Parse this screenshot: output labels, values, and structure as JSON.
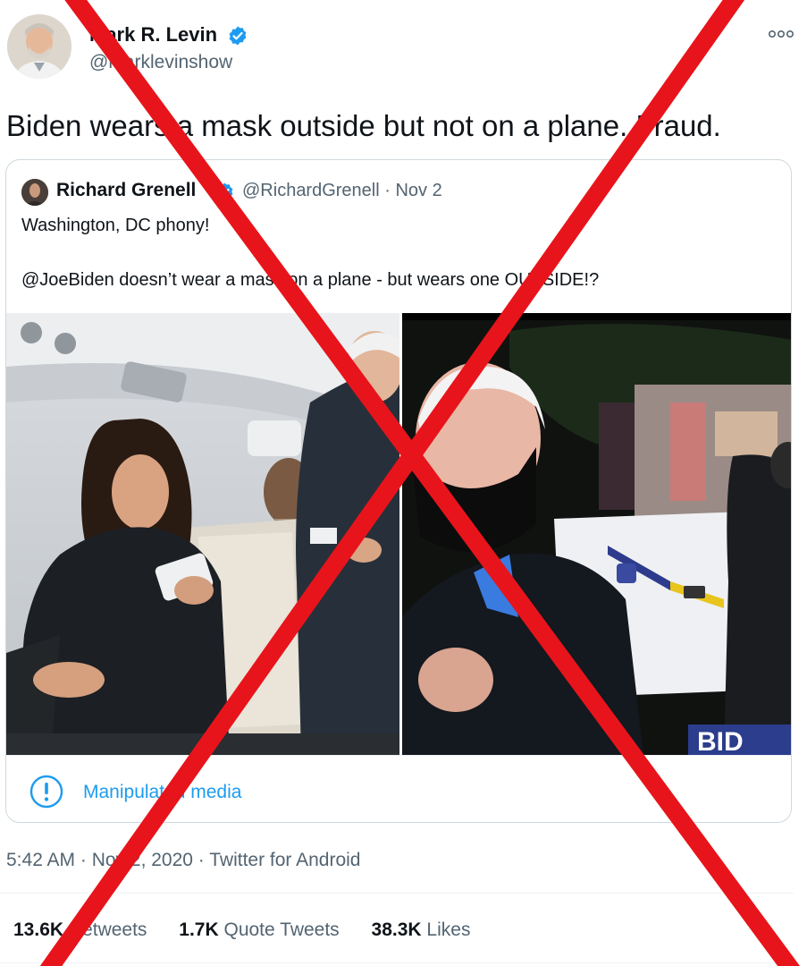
{
  "tweet": {
    "author": {
      "name": "Mark R. Levin",
      "handle": "@marklevinshow",
      "verified": true,
      "avatar": "avatar-photo"
    },
    "text": "Biden wears a mask outside but not on a plane. Fraud.",
    "more_icon": "more-horizontal-icon",
    "quoted": {
      "author_name": "Richard Grenell",
      "verified": true,
      "meta": "@RichardGrenell · Nov 2",
      "line1": "Washington, DC phony!",
      "line2": "@JoeBiden doesn’t wear a mask on a plane - but wears one OUTSIDE!?",
      "photo_right_caption": "BID",
      "notice": {
        "icon": "exclamation-circle-icon",
        "text": "Manipulated media"
      }
    },
    "timestamp": "5:42 AM · Nov 2, 2020 · Twitter for Android",
    "stats": {
      "retweets_count": "13.6K",
      "retweets_label": "Retweets",
      "quotes_count": "1.7K",
      "quotes_label": "Quote Tweets",
      "likes_count": "38.3K",
      "likes_label": "Likes"
    }
  },
  "colors": {
    "accent": "#1d9bf0",
    "overlay_x": "#e8141b",
    "muted_text": "#536471"
  }
}
